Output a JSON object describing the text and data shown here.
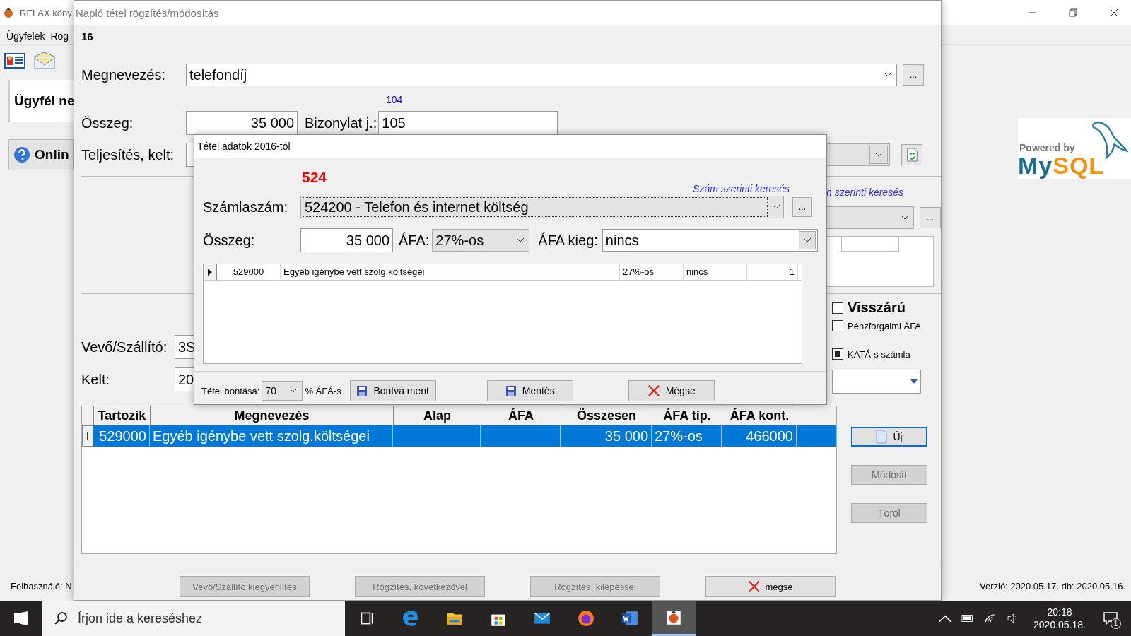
{
  "main_window": {
    "title": "RELAX köny",
    "menu": [
      "Ügyfelek",
      "Rög"
    ],
    "panel_label": "Ügyfél ne",
    "online_button": "Onlin",
    "logo_caption": "Powered by",
    "logo_parts": [
      "My",
      "SQL"
    ],
    "status_user": "Felhasználó: N",
    "status_version": "Verzió: 2020.05.17. db: 2020.05.16."
  },
  "journal_dialog": {
    "title": "Napló tétel rögzítés/módosítás",
    "record_number": "16",
    "name_label": "Megnevezés:",
    "name_value": "telefondíj",
    "counter": "104",
    "amount_label": "Összeg:",
    "amount_value": "35 000",
    "voucher_label": "Bizonylat j.:",
    "voucher_value": "105",
    "date_label": "Teljesítés, kelt:",
    "name_browse": "...",
    "account_browse": "...",
    "search_link": "n szerinti keresés",
    "partner_label": "Vevő/Szállító:",
    "partner_value": "3S",
    "issued_label": "Kelt:",
    "issued_value": "20",
    "checkboxes": [
      {
        "label": "Visszárú",
        "checked": false,
        "kind": "large"
      },
      {
        "label": "Pénzforgalmi ÁFA",
        "checked": false,
        "kind": "small"
      },
      {
        "label": "KATÁ-s számla",
        "checked": true,
        "kind": "small"
      }
    ],
    "table": {
      "columns": [
        "Tartozik",
        "Megnevezés",
        "Alap",
        "ÁFA",
        "Összesen",
        "ÁFA tip.",
        "ÁFA kont."
      ],
      "rows": [
        {
          "marker": "I",
          "selected": true,
          "cells": [
            "529000",
            "Egyéb igénybe vett szolg.költségei",
            null,
            null,
            "35 000",
            "27%-os",
            "466000"
          ]
        }
      ]
    },
    "side_buttons": [
      {
        "label": "Új",
        "disabled": false,
        "focused": true
      },
      {
        "label": "Módosít",
        "disabled": true,
        "focused": false
      },
      {
        "label": "Töröl",
        "disabled": true,
        "focused": false
      }
    ],
    "bottom_buttons": [
      {
        "label": "Vevő/Szállító kiegyenlítés",
        "disabled": true,
        "kind": "plain"
      },
      {
        "label": "Rögzítés, következővel",
        "disabled": true,
        "kind": "plain"
      },
      {
        "label": "Rögzítés, kilépéssel",
        "disabled": true,
        "kind": "plain"
      },
      {
        "label": "mégse",
        "disabled": false,
        "kind": "cancel"
      }
    ]
  },
  "item_dialog": {
    "title": "Tétel adatok 2016-tól",
    "account_prefix": "524",
    "search_link": "Szám szerinti keresés",
    "account_label": "Számlaszám:",
    "account_value": "524200 - Telefon és internet költség",
    "account_browse": "...",
    "amount_label": "Összeg:",
    "amount_value": "35 000",
    "vat_label": "ÁFA:",
    "vat_value": "27%-os",
    "vat_extra_label": "ÁFA kieg:",
    "vat_extra_value": "nincs",
    "grid_rows": [
      {
        "selected": true,
        "cells": [
          "529000",
          "Egyéb igénybe vett szolg.költségei",
          "27%-os",
          "nincs",
          "1"
        ]
      }
    ],
    "split_label": "Tétel bontása:",
    "split_value": "70",
    "split_suffix": "% ÁFÁ-s",
    "buttons": [
      {
        "label": "Bontva ment",
        "kind": "save"
      },
      {
        "label": "Mentés",
        "kind": "save"
      },
      {
        "label": "Mégse",
        "kind": "cancel"
      }
    ]
  },
  "taskbar": {
    "search_placeholder": "Írjon ide a kereséshez",
    "apps": [
      {
        "kind": "task-view",
        "active": false
      },
      {
        "kind": "browser",
        "active": false
      },
      {
        "kind": "folder",
        "active": false
      },
      {
        "kind": "store",
        "active": false
      },
      {
        "kind": "mail",
        "active": false
      },
      {
        "kind": "firefox",
        "active": false
      },
      {
        "kind": "word",
        "active": false
      },
      {
        "kind": "relax",
        "active": true
      }
    ],
    "time": "20:18",
    "date": "2020.05.18.",
    "notifications": "1"
  }
}
